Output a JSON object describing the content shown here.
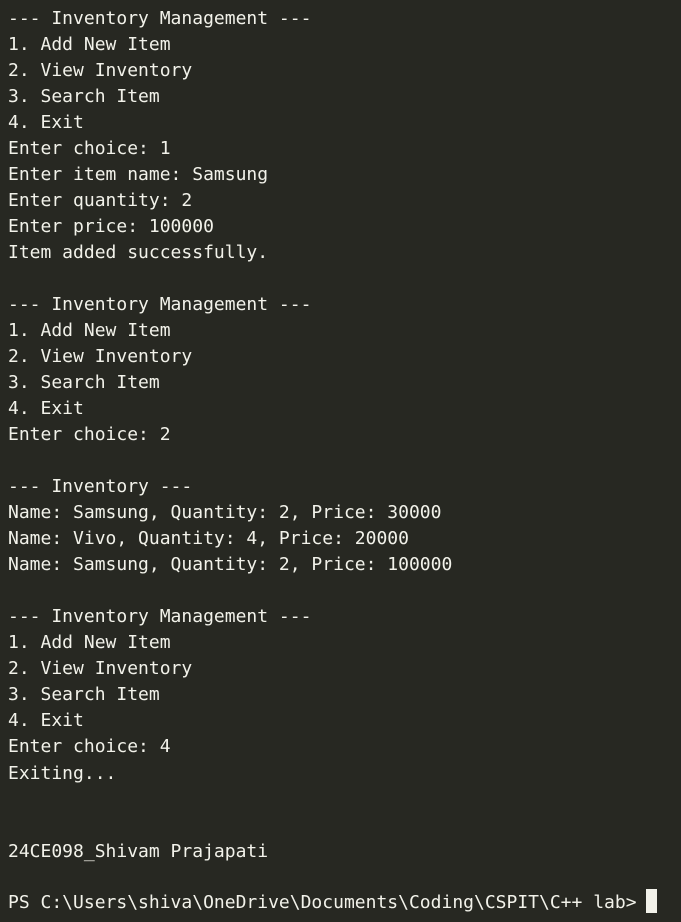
{
  "terminal": {
    "lines": [
      "--- Inventory Management ---",
      "1. Add New Item",
      "2. View Inventory",
      "3. Search Item",
      "4. Exit",
      "Enter choice: 1",
      "Enter item name: Samsung",
      "Enter quantity: 2",
      "Enter price: 100000",
      "Item added successfully.",
      "--- Inventory Management ---",
      "1. Add New Item",
      "2. View Inventory",
      "3. Search Item",
      "4. Exit",
      "Enter choice: 2",
      "--- Inventory ---",
      "Name: Samsung, Quantity: 2, Price: 30000",
      "Name: Vivo, Quantity: 4, Price: 20000",
      "Name: Samsung, Quantity: 2, Price: 100000",
      "--- Inventory Management ---",
      "1. Add New Item",
      "2. View Inventory",
      "3. Search Item",
      "4. Exit",
      "Enter choice: 4",
      "Exiting...",
      "24CE098_Shivam Prajapati"
    ],
    "prompt": "PS C:\\Users\\shiva\\OneDrive\\Documents\\Coding\\CSPIT\\C++ lab>"
  },
  "colors": {
    "background": "#272822",
    "foreground": "#f2f2ea"
  }
}
